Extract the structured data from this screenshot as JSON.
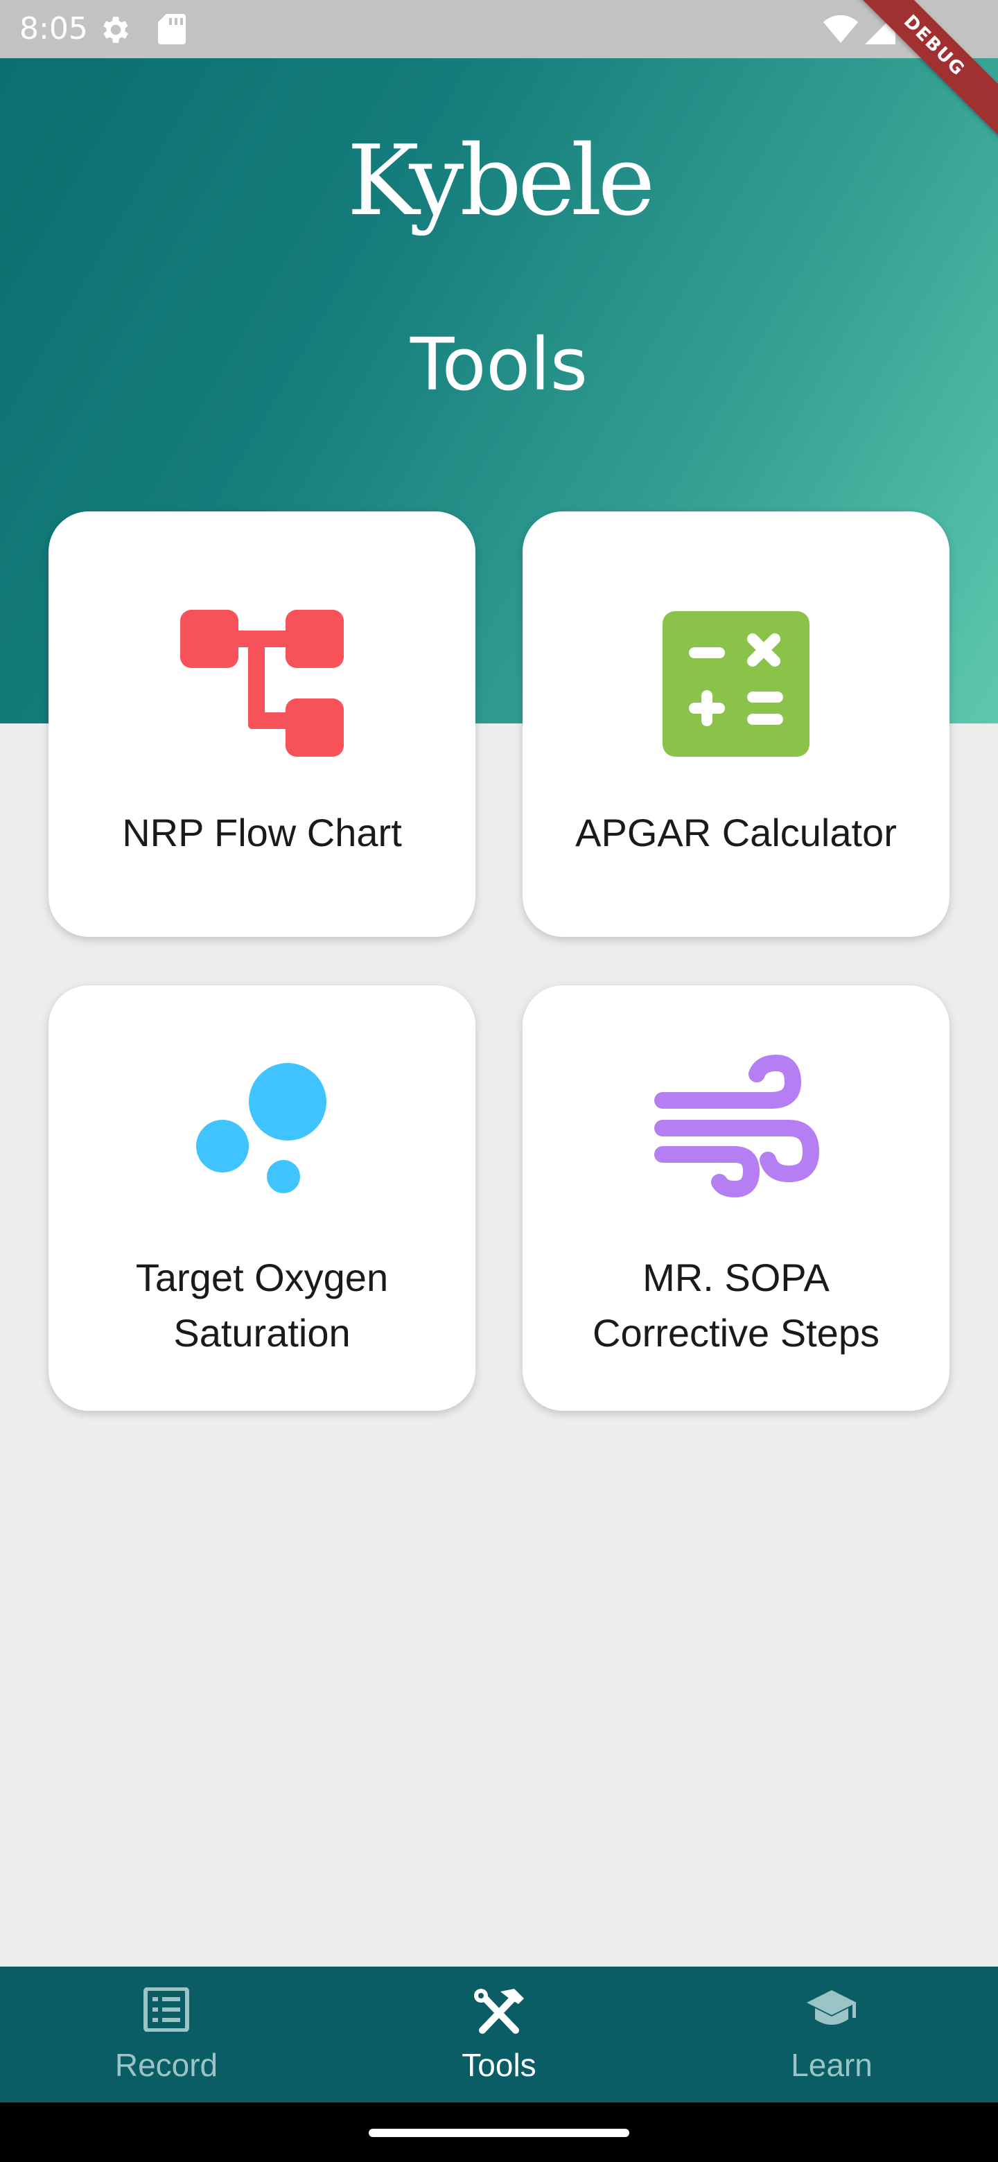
{
  "status_bar": {
    "time": "8:05",
    "icons": [
      "settings-icon",
      "sd-card-icon",
      "wifi-icon",
      "signal-icon",
      "battery-icon"
    ]
  },
  "debug_ribbon": "DEBUG",
  "header": {
    "brand": "Kybele",
    "title": "Tools",
    "gradient_colors": [
      "#0b6e70",
      "#5ec8ae"
    ]
  },
  "tools": [
    {
      "label": "NRP Flow Chart",
      "icon": "flowchart-icon",
      "color": "#f7525a"
    },
    {
      "label": "APGAR Calculator",
      "icon": "calculator-icon",
      "color": "#8bc34a"
    },
    {
      "label_line1": "Target Oxygen",
      "label_line2": "Saturation",
      "icon": "bubbles-icon",
      "color": "#40c4ff"
    },
    {
      "label_line1": "MR. SOPA",
      "label_line2": "Corrective Steps",
      "icon": "wind-icon",
      "color": "#b57ef2"
    }
  ],
  "bottom_nav": {
    "items": [
      {
        "label": "Record",
        "icon": "list-icon",
        "active": false
      },
      {
        "label": "Tools",
        "icon": "tools-icon",
        "active": true
      },
      {
        "label": "Learn",
        "icon": "graduation-cap-icon",
        "active": false
      }
    ],
    "background": "#0a5c65"
  }
}
